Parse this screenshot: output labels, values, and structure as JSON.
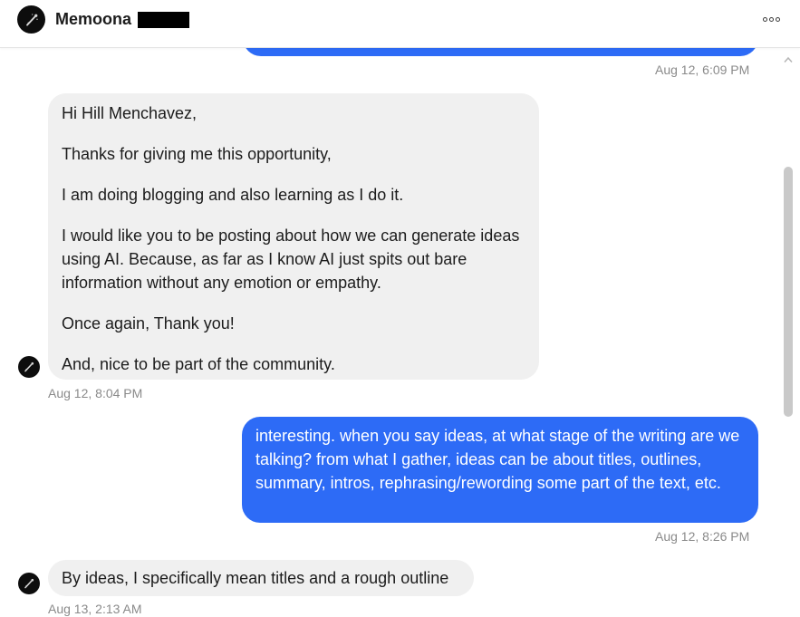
{
  "header": {
    "contact_name": "Memoona"
  },
  "icons": {
    "avatar": "avatar-icon",
    "more": "more-horizontal-icon",
    "scroll_up": "chevron-up-icon"
  },
  "colors": {
    "outgoing_bubble": "#2d6bf6",
    "incoming_bubble": "#f0f0f0",
    "timestamp": "#8a8a8a"
  },
  "messages": [
    {
      "direction": "outgoing",
      "lines": [],
      "timestamp": "Aug 12, 6:09 PM"
    },
    {
      "direction": "incoming",
      "lines": [
        "Hi Hill Menchavez,",
        "Thanks for giving me this opportunity,",
        "I am doing blogging and also learning as I do it.",
        "I would like you to be posting about how we can generate ideas using AI. Because, as far as I know AI just spits out bare information without any emotion or empathy.",
        "Once again, Thank you!",
        "And, nice to be part of the community."
      ],
      "timestamp": "Aug 12, 8:04 PM"
    },
    {
      "direction": "outgoing",
      "lines": [
        "interesting. when you say ideas, at what stage of the writing are we talking? from what I gather, ideas can be about titles, outlines, summary, intros, rephrasing/rewording some part of the text, etc."
      ],
      "timestamp": "Aug 12, 8:26 PM"
    },
    {
      "direction": "incoming",
      "lines": [
        "By ideas, I specifically mean titles and a rough outline"
      ],
      "timestamp": "Aug 13, 2:13 AM"
    }
  ]
}
